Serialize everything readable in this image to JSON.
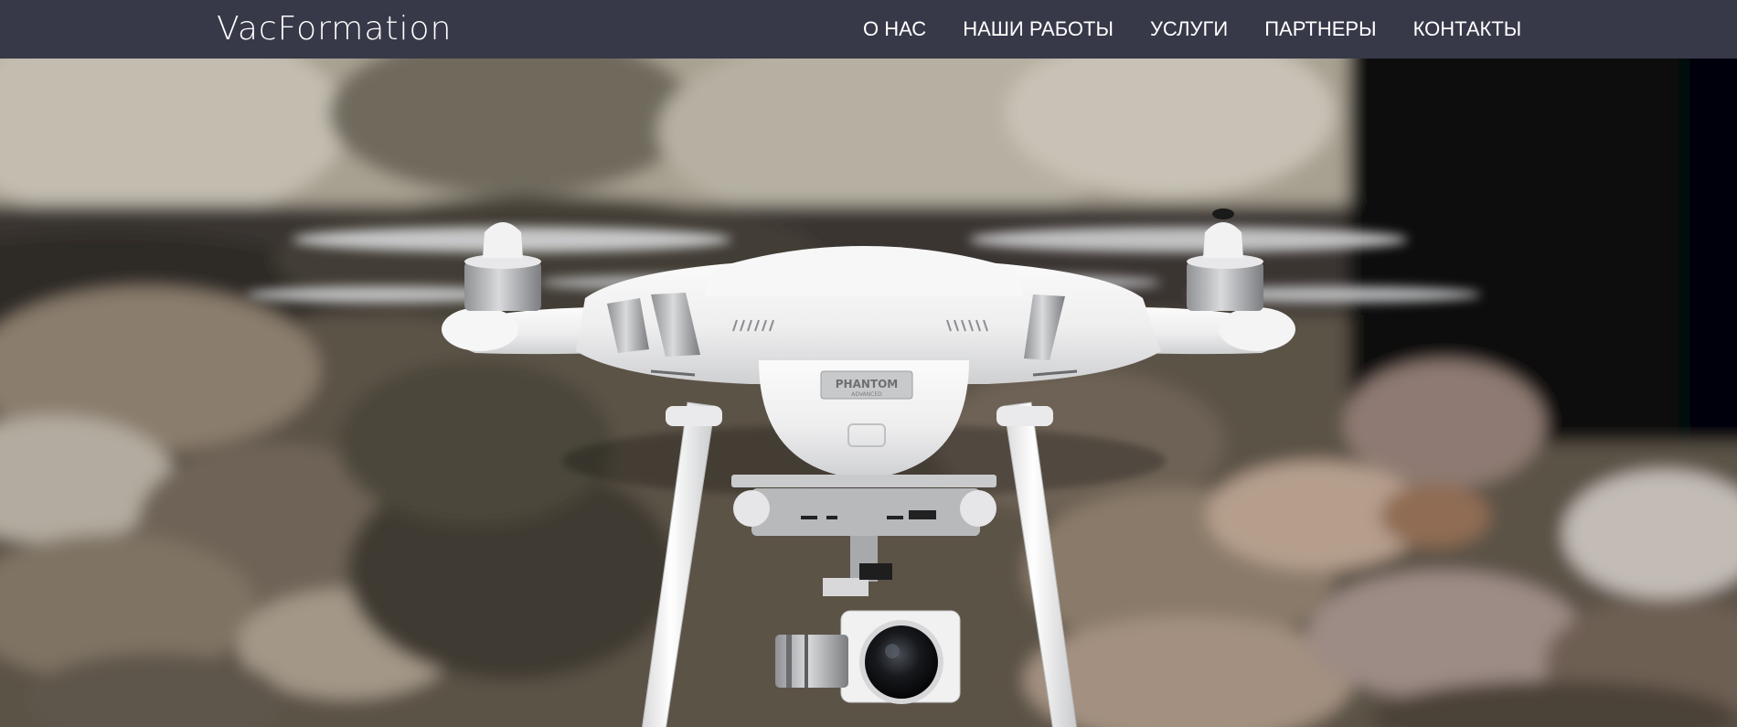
{
  "header": {
    "logo_text": "VacFormation",
    "nav": [
      {
        "label": "О НАС"
      },
      {
        "label": "НАШИ РАБОТЫ"
      },
      {
        "label": "УСЛУГИ"
      },
      {
        "label": "ПАРТНЕРЫ"
      },
      {
        "label": "КОНТАКТЫ"
      }
    ],
    "background_color": "#373949",
    "text_color": "#ffffff"
  },
  "hero": {
    "drone_badge_text": "PHANTOM",
    "drone_badge_subtext": "ADVANCED"
  }
}
